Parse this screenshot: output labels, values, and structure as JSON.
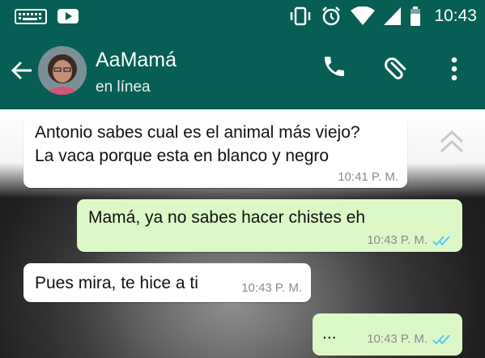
{
  "status_bar": {
    "time": "10:43",
    "icons": [
      "keyboard-icon",
      "youtube-icon",
      "vibrate-icon",
      "alarm-icon",
      "wifi-icon",
      "signal-icon",
      "battery-icon"
    ]
  },
  "header": {
    "name": "AaMamá",
    "status": "en línea",
    "icons": [
      "back-arrow-icon",
      "phone-icon",
      "attach-icon",
      "more-icon"
    ],
    "color": "#075E54"
  },
  "messages": [
    {
      "direction": "in",
      "text": [
        "Antonio sabes cual es el animal más viejo?",
        "La vaca porque esta en blanco y negro"
      ],
      "time": "10:41 P. M."
    },
    {
      "direction": "out",
      "text": [
        "Mamá, ya no sabes hacer chistes eh"
      ],
      "time": "10:43 P. M.",
      "ticks": "double-check-icon"
    },
    {
      "direction": "in",
      "text": [
        "Pues mira, te hice a ti"
      ],
      "time": "10:43 P. M."
    },
    {
      "direction": "out",
      "text": [
        "..."
      ],
      "time": "10:43 P. M.",
      "ticks": "double-check-icon"
    }
  ],
  "colors": {
    "incoming": "#FFFFFF",
    "outgoing": "#DCF8C6",
    "read_ticks": "#4FC3F7"
  }
}
